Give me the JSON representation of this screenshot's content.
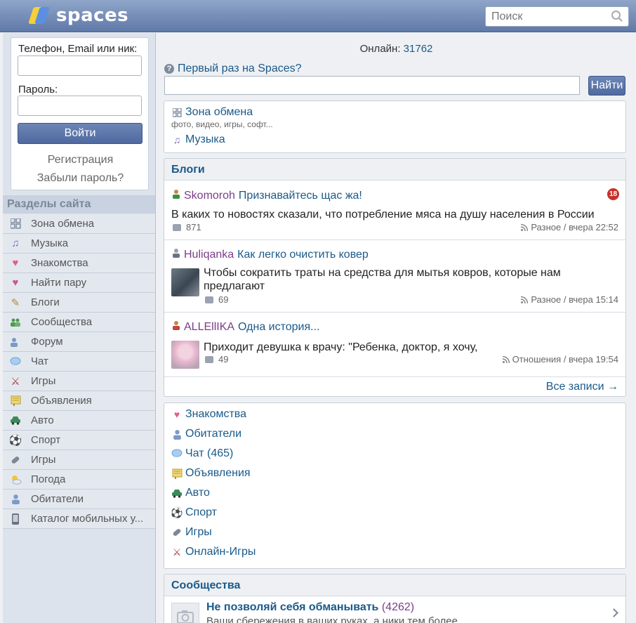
{
  "header": {
    "logo_text": "spaces",
    "search_placeholder": "Поиск"
  },
  "login": {
    "login_label": "Телефон, Email или ник:",
    "password_label": "Пароль:",
    "submit": "Войти",
    "register": "Регистрация",
    "forgot": "Забыли пароль?"
  },
  "sidebar": {
    "title": "Разделы сайта",
    "items": [
      {
        "label": "Зона обмена",
        "icon": "grid-icon"
      },
      {
        "label": "Музыка",
        "icon": "music-note-icon"
      },
      {
        "label": "Знакомства",
        "icon": "heart-icon"
      },
      {
        "label": "Найти пару",
        "icon": "broken-heart-icon"
      },
      {
        "label": "Блоги",
        "icon": "pencil-icon"
      },
      {
        "label": "Сообщества",
        "icon": "group-icon"
      },
      {
        "label": "Форум",
        "icon": "forum-icon"
      },
      {
        "label": "Чат",
        "icon": "chat-bubble-icon"
      },
      {
        "label": "Игры",
        "icon": "crossed-swords-icon"
      },
      {
        "label": "Объявления",
        "icon": "notice-board-icon"
      },
      {
        "label": "Авто",
        "icon": "car-icon"
      },
      {
        "label": "Спорт",
        "icon": "soccer-ball-icon"
      },
      {
        "label": "Игры",
        "icon": "gamepad-icon"
      },
      {
        "label": "Погода",
        "icon": "weather-icon"
      },
      {
        "label": "Обитатели",
        "icon": "user-icon"
      },
      {
        "label": "Каталог мобильных у...",
        "icon": "phone-icon"
      }
    ]
  },
  "main": {
    "online_label": "Онлайн:",
    "online_count": "31762",
    "first_time": "Первый раз на Spaces?",
    "find_button": "Найти",
    "exchange": {
      "title": "Зона обмена",
      "subtitle": "фото, видео, игры, софт...",
      "music": "Музыка"
    },
    "blogs": {
      "title": "Блоги",
      "all": "Все записи →",
      "posts": [
        {
          "author": "Skomoroh",
          "title": "Признавайтесь щас жа!",
          "badge": "18",
          "text": "В каких то новостях сказали, что потребление мяса на душу населения в России",
          "comments": "871",
          "meta": "Разное / вчера 22:52"
        },
        {
          "author": "Huliqanka",
          "title": "Как легко очистить ковер",
          "text": "Чтобы сократить траты на средства для мытья ковров, которые нам предлагают",
          "comments": "69",
          "meta": "Разное / вчера 15:14"
        },
        {
          "author": "ALLEllIKA",
          "title": "Одна история...",
          "text": "Приходит девушка к врачу: \"Ребенка, доктор, я хочу,",
          "comments": "49",
          "meta": "Отношения / вчера 19:54"
        }
      ]
    },
    "links": [
      {
        "label": "Знакомства",
        "icon": "heart-icon"
      },
      {
        "label": "Обитатели",
        "icon": "user-icon"
      },
      {
        "label": "Чат (465)",
        "icon": "chat-bubble-icon"
      },
      {
        "label": "Объявления",
        "icon": "notice-board-icon"
      },
      {
        "label": "Авто",
        "icon": "car-icon"
      },
      {
        "label": "Спорт",
        "icon": "soccer-ball-icon"
      },
      {
        "label": "Игры",
        "icon": "gamepad-icon"
      },
      {
        "label": "Онлайн-Игры",
        "icon": "crossed-swords-icon"
      }
    ],
    "communities": {
      "title": "Сообщества",
      "item": {
        "name": "Не позволяй себя обманывать",
        "count": "(4262)",
        "desc": "Ваши сбережения в ваших руках, а ники тем более"
      }
    }
  }
}
